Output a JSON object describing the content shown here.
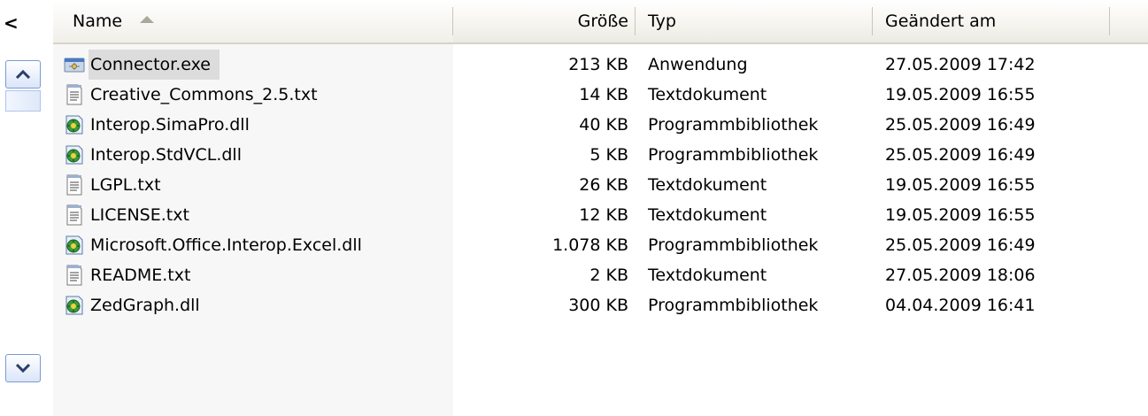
{
  "nav": {
    "collapse_glyph": "<"
  },
  "columns": {
    "name": "Name",
    "size": "Größe",
    "type": "Typ",
    "modified": "Geändert am"
  },
  "files": [
    {
      "icon": "exe-icon",
      "name": "Connector.exe",
      "size": "213 KB",
      "type": "Anwendung",
      "modified": "27.05.2009 17:42",
      "selected": true
    },
    {
      "icon": "text-file-icon",
      "name": "Creative_Commons_2.5.txt",
      "size": "14 KB",
      "type": "Textdokument",
      "modified": "19.05.2009 16:55"
    },
    {
      "icon": "dll-icon",
      "name": "Interop.SimaPro.dll",
      "size": "40 KB",
      "type": "Programmbibliothek",
      "modified": "25.05.2009 16:49"
    },
    {
      "icon": "dll-icon",
      "name": "Interop.StdVCL.dll",
      "size": "5 KB",
      "type": "Programmbibliothek",
      "modified": "25.05.2009 16:49"
    },
    {
      "icon": "text-file-icon",
      "name": "LGPL.txt",
      "size": "26 KB",
      "type": "Textdokument",
      "modified": "19.05.2009 16:55"
    },
    {
      "icon": "text-file-icon",
      "name": "LICENSE.txt",
      "size": "12 KB",
      "type": "Textdokument",
      "modified": "19.05.2009 16:55"
    },
    {
      "icon": "dll-icon",
      "name": "Microsoft.Office.Interop.Excel.dll",
      "size": "1.078 KB",
      "type": "Programmbibliothek",
      "modified": "25.05.2009 16:49"
    },
    {
      "icon": "text-file-icon",
      "name": "README.txt",
      "size": "2 KB",
      "type": "Textdokument",
      "modified": "27.05.2009 18:06"
    },
    {
      "icon": "dll-icon",
      "name": "ZedGraph.dll",
      "size": "300 KB",
      "type": "Programmbibliothek",
      "modified": "04.04.2009 16:41"
    }
  ],
  "colors": {
    "selection": "#dcdcdc",
    "scroll_border": "#7a9bd3"
  }
}
